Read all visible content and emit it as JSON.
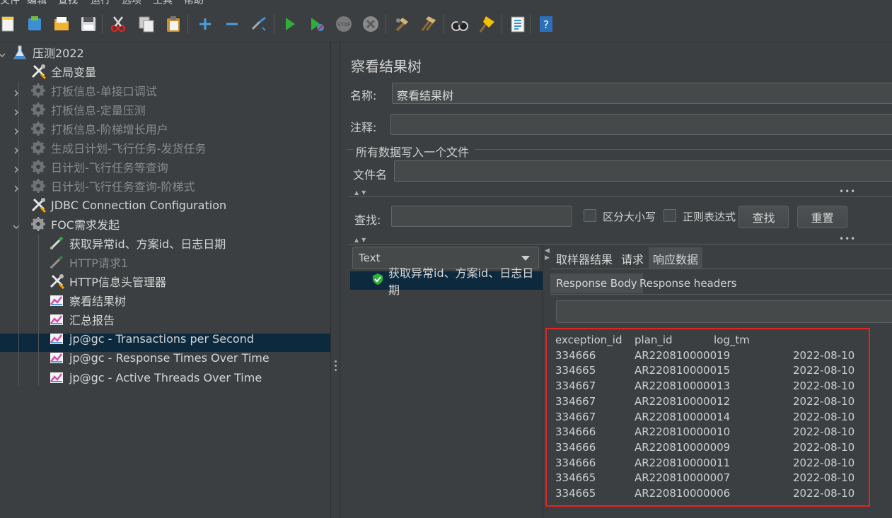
{
  "menu": [
    "文件",
    "编辑",
    "查找",
    "运行",
    "选项",
    "工具",
    "帮助"
  ],
  "toolbar_icons": [
    "new-icon",
    "templates-icon",
    "open-icon",
    "save-icon",
    "cut-icon",
    "copy-icon",
    "paste-icon",
    "expand-icon",
    "collapse-icon",
    "toggle-icon",
    "start-icon",
    "start-no-timers-icon",
    "stop-icon",
    "shutdown-icon",
    "clear-icon",
    "clear-all-icon",
    "search-icon",
    "reset-search-icon",
    "function-helper-icon",
    "help-icon"
  ],
  "tree": {
    "root": "压测2022",
    "items": [
      {
        "label": "全局变量",
        "icon": "tools-icon",
        "disabled": false
      },
      {
        "label": "打板信息-单接口调试",
        "icon": "gear-icon",
        "disabled": true
      },
      {
        "label": "打板信息-定量压测",
        "icon": "gear-icon",
        "disabled": true
      },
      {
        "label": "打板信息-阶梯增长用户",
        "icon": "gear-icon",
        "disabled": true
      },
      {
        "label": "生成日计划-飞行任务-发货任务",
        "icon": "gear-icon",
        "disabled": true
      },
      {
        "label": "日计划-飞行任务等查询",
        "icon": "gear-icon",
        "disabled": true
      },
      {
        "label": "日计划-飞行任务查询-阶梯式",
        "icon": "gear-icon",
        "disabled": true
      },
      {
        "label": "JDBC Connection Configuration",
        "icon": "tools-icon",
        "disabled": false
      },
      {
        "label": "FOC需求发起",
        "icon": "gear-icon",
        "disabled": false
      },
      {
        "label": "获取异常id、方案id、日志日期",
        "icon": "pipette-icon",
        "disabled": false
      },
      {
        "label": "HTTP请求1",
        "icon": "pipette-icon",
        "disabled": true
      },
      {
        "label": "HTTP信息头管理器",
        "icon": "tools-icon",
        "disabled": false
      },
      {
        "label": "察看结果树",
        "icon": "chart-icon",
        "disabled": false
      },
      {
        "label": "汇总报告",
        "icon": "chart-icon",
        "disabled": false
      },
      {
        "label": "jp@gc - Transactions per Second",
        "icon": "chart-icon",
        "disabled": false
      },
      {
        "label": "jp@gc - Response Times Over Time",
        "icon": "chart-icon",
        "disabled": false
      },
      {
        "label": "jp@gc - Active Threads Over Time",
        "icon": "chart-icon",
        "disabled": false
      }
    ]
  },
  "panel": {
    "title": "察看结果树",
    "name_label": "名称:",
    "name_value": "察看结果树",
    "comment_label": "注释:",
    "comment_value": "",
    "group_label": "所有数据写入一个文件",
    "filename_label": "文件名",
    "filename_value": "",
    "search_label": "查找:",
    "search_value": "",
    "case_sensitive": "区分大小写",
    "regex": "正则表达式",
    "find_button": "查找",
    "reset_button": "重置",
    "renderer": "Text",
    "result_item": "获取异常id、方案id、日志日期",
    "tabs": [
      "取样器结果",
      "请求",
      "响应数据"
    ],
    "active_tab": "响应数据",
    "subtabs": [
      "Response Body",
      "Response headers"
    ],
    "active_subtab": "Response Body"
  },
  "response": {
    "headers": [
      "exception_id",
      "plan_id",
      "log_tm"
    ],
    "rows": [
      [
        "334666",
        "AR220810000019",
        "2022-08-10"
      ],
      [
        "334665",
        "AR220810000015",
        "2022-08-10"
      ],
      [
        "334667",
        "AR220810000013",
        "2022-08-10"
      ],
      [
        "334667",
        "AR220810000012",
        "2022-08-10"
      ],
      [
        "334667",
        "AR220810000014",
        "2022-08-10"
      ],
      [
        "334666",
        "AR220810000010",
        "2022-08-10"
      ],
      [
        "334666",
        "AR220810000009",
        "2022-08-10"
      ],
      [
        "334666",
        "AR220810000011",
        "2022-08-10"
      ],
      [
        "334665",
        "AR220810000007",
        "2022-08-10"
      ],
      [
        "334665",
        "AR220810000006",
        "2022-08-10"
      ]
    ]
  },
  "colors": {
    "selection": "#0d293e",
    "highlight_border": "#e02525",
    "background": "#3c3f41"
  }
}
